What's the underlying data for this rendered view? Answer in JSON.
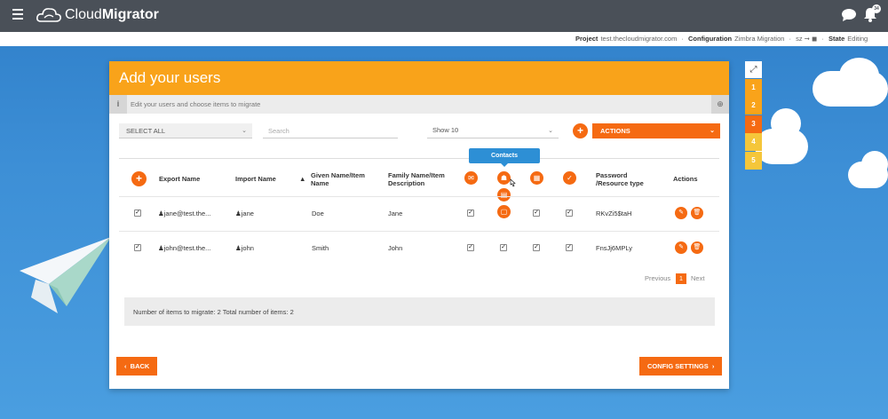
{
  "app": {
    "name_prefix": "Cloud",
    "name_suffix": "Migrator",
    "notification_count": "34"
  },
  "breadcrumb": {
    "project_label": "Project",
    "project_value": "test.thecloudmigrator.com",
    "config_label": "Configuration",
    "config_value": "Zimbra Migration",
    "flow_text": "›",
    "state_label": "State",
    "state_value": "Editing"
  },
  "card": {
    "title": "Add your users",
    "info_text": "Edit your users and choose items to migrate",
    "select_all": "SELECT ALL",
    "search_placeholder": "Search",
    "show_value": "Show 10",
    "actions_label": "ACTIONS"
  },
  "table": {
    "headers": {
      "export": "Export Name",
      "import": "Import Name",
      "given": "Given Name/Item Name",
      "family": "Family Name/Item Description",
      "password": "Password /Resource type",
      "actions": "Actions"
    },
    "tooltip": "Contacts",
    "rows": [
      {
        "export": "jane@test.the...",
        "import": "jane",
        "given": "Doe",
        "family": "Jane",
        "password": "RKvZi5$taH"
      },
      {
        "export": "john@test.the...",
        "import": "john",
        "given": "Smith",
        "family": "John",
        "password": "FnsJj6MPLy"
      }
    ]
  },
  "pagination": {
    "previous": "Previous",
    "page": "1",
    "next": "Next"
  },
  "summary": "Number of items to migrate: 2 Total number of items: 2",
  "buttons": {
    "back": "BACK",
    "config": "CONFIG SETTINGS"
  },
  "steps": [
    "1",
    "2",
    "3",
    "4",
    "5"
  ],
  "colors": {
    "accent": "#f56a12",
    "header": "#f9a31a",
    "topbar": "#4a5058",
    "tooltip": "#2d8fd5"
  }
}
